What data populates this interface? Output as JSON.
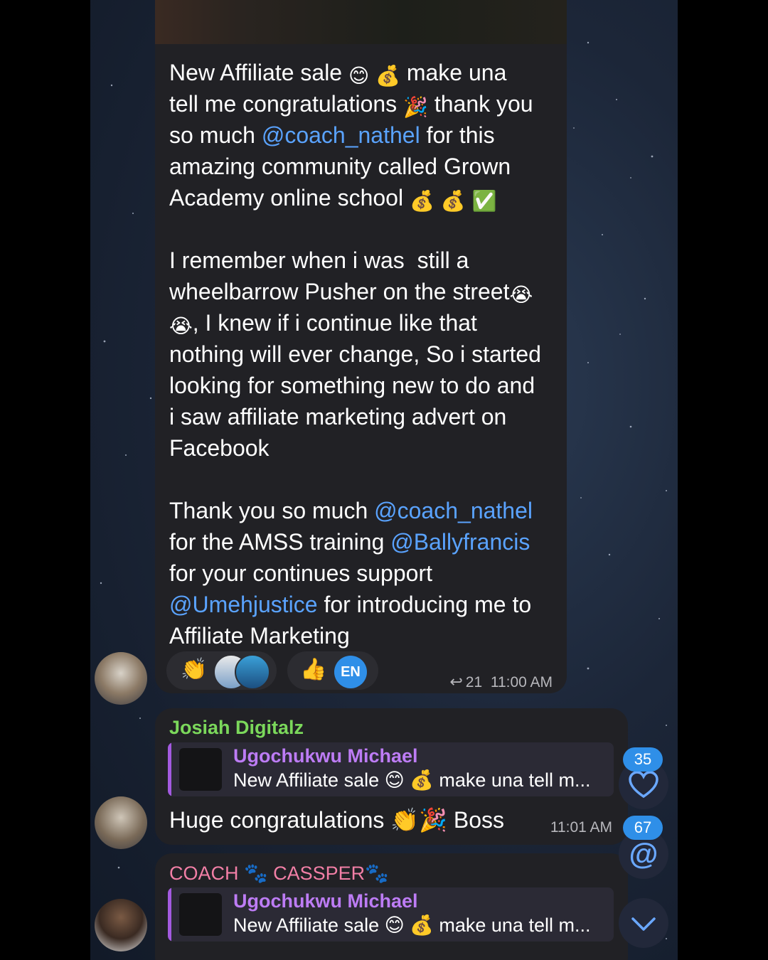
{
  "message1": {
    "text_parts": {
      "p1": "New Affiliate sale ",
      "p2": " make una\ntell me congratulations ",
      "p3": " thank you\nso much ",
      "mention1": "@coach_nathel",
      "p4": " for this\namazing community called Grown\nAcademy online school ",
      "p5": "\n\nI remember when i was  still a\nwheelbarrow Pusher on the street",
      "p6": "\n",
      "p7": ", I knew if i continue like that\nnothing will ever change, So i started\nlooking for something new to do and\ni saw affiliate marketing advert on\nFacebook\n\nThank you so much ",
      "mention2": "@coach_nathel",
      "p8": "\nfor the AMSS training ",
      "mention3": "@Ballyfrancis",
      "p9": "\nfor your continues support\n",
      "mention4": "@Umehjustice",
      "p10": " for introducing me to\nAffiliate Marketing"
    },
    "emojis": {
      "smile": "😊",
      "moneybag": "💰",
      "party": "🎉",
      "check": "✅",
      "cry": "😭"
    },
    "reactions": [
      {
        "emoji": "👏"
      },
      {
        "emoji": "👍",
        "label": "EN"
      }
    ],
    "reply_count": "21",
    "time": "11:00 AM"
  },
  "message2": {
    "sender": "Josiah Digitalz",
    "sender_color": "#7bd85b",
    "quote_name": "Ugochukwu Michael",
    "quote_text": "New Affiliate sale 😊 💰  make una tell m...",
    "body": "Huge congratulations 👏🎉 Boss",
    "time": "11:01 AM"
  },
  "message3": {
    "sender": "COACH 🐾 CASSPER🐾",
    "sender_color": "#f27fa6",
    "quote_name": "Ugochukwu Michael",
    "quote_text": "New Affiliate sale 😊 💰  make una tell m..."
  },
  "fabs": {
    "reactions_badge": "35",
    "mentions_badge": "67",
    "heart_icon": "heart-icon",
    "at_icon": "at-icon",
    "down_icon": "chevron-down-icon"
  },
  "colors": {
    "mention": "#5aa3ff",
    "bubble": "#212125",
    "accent": "#2f8fe8"
  }
}
